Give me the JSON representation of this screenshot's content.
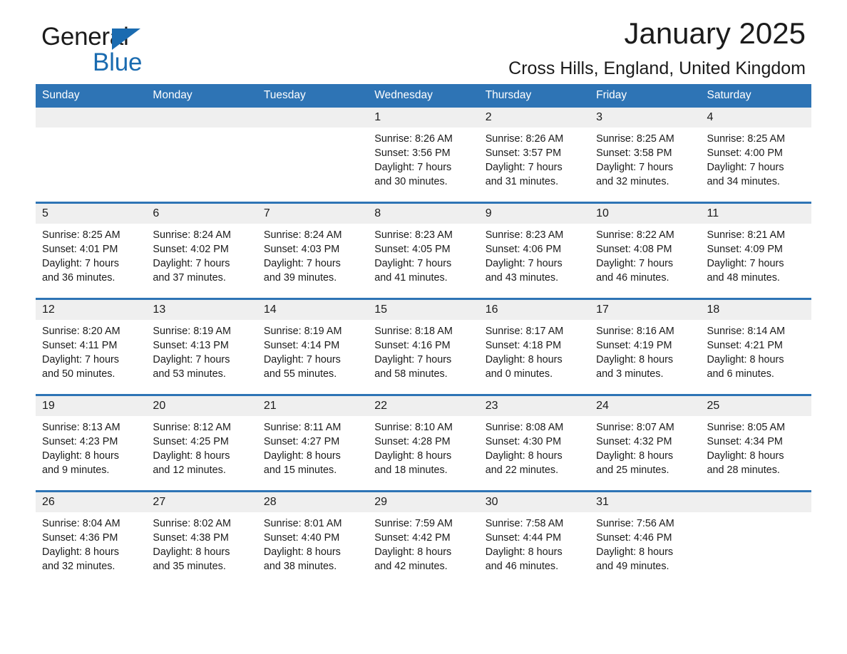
{
  "brand": {
    "name_part1": "General",
    "name_part2": "Blue",
    "triangle_color": "#1a6bb0",
    "logo_icon": "triangle-logo-icon"
  },
  "header": {
    "title": "January 2025",
    "subtitle": "Cross Hills, England, United Kingdom"
  },
  "theme": {
    "header_blue": "#2e74b5",
    "daynum_gray": "#efefef",
    "text": "#1b1b1b"
  },
  "calendar": {
    "weekday_headers": [
      "Sunday",
      "Monday",
      "Tuesday",
      "Wednesday",
      "Thursday",
      "Friday",
      "Saturday"
    ],
    "weeks": [
      [
        {
          "day": "",
          "empty": true
        },
        {
          "day": "",
          "empty": true
        },
        {
          "day": "",
          "empty": true
        },
        {
          "day": "1",
          "sunrise": "Sunrise: 8:26 AM",
          "sunset": "Sunset: 3:56 PM",
          "daylight_line1": "Daylight: 7 hours",
          "daylight_line2": "and 30 minutes."
        },
        {
          "day": "2",
          "sunrise": "Sunrise: 8:26 AM",
          "sunset": "Sunset: 3:57 PM",
          "daylight_line1": "Daylight: 7 hours",
          "daylight_line2": "and 31 minutes."
        },
        {
          "day": "3",
          "sunrise": "Sunrise: 8:25 AM",
          "sunset": "Sunset: 3:58 PM",
          "daylight_line1": "Daylight: 7 hours",
          "daylight_line2": "and 32 minutes."
        },
        {
          "day": "4",
          "sunrise": "Sunrise: 8:25 AM",
          "sunset": "Sunset: 4:00 PM",
          "daylight_line1": "Daylight: 7 hours",
          "daylight_line2": "and 34 minutes."
        }
      ],
      [
        {
          "day": "5",
          "sunrise": "Sunrise: 8:25 AM",
          "sunset": "Sunset: 4:01 PM",
          "daylight_line1": "Daylight: 7 hours",
          "daylight_line2": "and 36 minutes."
        },
        {
          "day": "6",
          "sunrise": "Sunrise: 8:24 AM",
          "sunset": "Sunset: 4:02 PM",
          "daylight_line1": "Daylight: 7 hours",
          "daylight_line2": "and 37 minutes."
        },
        {
          "day": "7",
          "sunrise": "Sunrise: 8:24 AM",
          "sunset": "Sunset: 4:03 PM",
          "daylight_line1": "Daylight: 7 hours",
          "daylight_line2": "and 39 minutes."
        },
        {
          "day": "8",
          "sunrise": "Sunrise: 8:23 AM",
          "sunset": "Sunset: 4:05 PM",
          "daylight_line1": "Daylight: 7 hours",
          "daylight_line2": "and 41 minutes."
        },
        {
          "day": "9",
          "sunrise": "Sunrise: 8:23 AM",
          "sunset": "Sunset: 4:06 PM",
          "daylight_line1": "Daylight: 7 hours",
          "daylight_line2": "and 43 minutes."
        },
        {
          "day": "10",
          "sunrise": "Sunrise: 8:22 AM",
          "sunset": "Sunset: 4:08 PM",
          "daylight_line1": "Daylight: 7 hours",
          "daylight_line2": "and 46 minutes."
        },
        {
          "day": "11",
          "sunrise": "Sunrise: 8:21 AM",
          "sunset": "Sunset: 4:09 PM",
          "daylight_line1": "Daylight: 7 hours",
          "daylight_line2": "and 48 minutes."
        }
      ],
      [
        {
          "day": "12",
          "sunrise": "Sunrise: 8:20 AM",
          "sunset": "Sunset: 4:11 PM",
          "daylight_line1": "Daylight: 7 hours",
          "daylight_line2": "and 50 minutes."
        },
        {
          "day": "13",
          "sunrise": "Sunrise: 8:19 AM",
          "sunset": "Sunset: 4:13 PM",
          "daylight_line1": "Daylight: 7 hours",
          "daylight_line2": "and 53 minutes."
        },
        {
          "day": "14",
          "sunrise": "Sunrise: 8:19 AM",
          "sunset": "Sunset: 4:14 PM",
          "daylight_line1": "Daylight: 7 hours",
          "daylight_line2": "and 55 minutes."
        },
        {
          "day": "15",
          "sunrise": "Sunrise: 8:18 AM",
          "sunset": "Sunset: 4:16 PM",
          "daylight_line1": "Daylight: 7 hours",
          "daylight_line2": "and 58 minutes."
        },
        {
          "day": "16",
          "sunrise": "Sunrise: 8:17 AM",
          "sunset": "Sunset: 4:18 PM",
          "daylight_line1": "Daylight: 8 hours",
          "daylight_line2": "and 0 minutes."
        },
        {
          "day": "17",
          "sunrise": "Sunrise: 8:16 AM",
          "sunset": "Sunset: 4:19 PM",
          "daylight_line1": "Daylight: 8 hours",
          "daylight_line2": "and 3 minutes."
        },
        {
          "day": "18",
          "sunrise": "Sunrise: 8:14 AM",
          "sunset": "Sunset: 4:21 PM",
          "daylight_line1": "Daylight: 8 hours",
          "daylight_line2": "and 6 minutes."
        }
      ],
      [
        {
          "day": "19",
          "sunrise": "Sunrise: 8:13 AM",
          "sunset": "Sunset: 4:23 PM",
          "daylight_line1": "Daylight: 8 hours",
          "daylight_line2": "and 9 minutes."
        },
        {
          "day": "20",
          "sunrise": "Sunrise: 8:12 AM",
          "sunset": "Sunset: 4:25 PM",
          "daylight_line1": "Daylight: 8 hours",
          "daylight_line2": "and 12 minutes."
        },
        {
          "day": "21",
          "sunrise": "Sunrise: 8:11 AM",
          "sunset": "Sunset: 4:27 PM",
          "daylight_line1": "Daylight: 8 hours",
          "daylight_line2": "and 15 minutes."
        },
        {
          "day": "22",
          "sunrise": "Sunrise: 8:10 AM",
          "sunset": "Sunset: 4:28 PM",
          "daylight_line1": "Daylight: 8 hours",
          "daylight_line2": "and 18 minutes."
        },
        {
          "day": "23",
          "sunrise": "Sunrise: 8:08 AM",
          "sunset": "Sunset: 4:30 PM",
          "daylight_line1": "Daylight: 8 hours",
          "daylight_line2": "and 22 minutes."
        },
        {
          "day": "24",
          "sunrise": "Sunrise: 8:07 AM",
          "sunset": "Sunset: 4:32 PM",
          "daylight_line1": "Daylight: 8 hours",
          "daylight_line2": "and 25 minutes."
        },
        {
          "day": "25",
          "sunrise": "Sunrise: 8:05 AM",
          "sunset": "Sunset: 4:34 PM",
          "daylight_line1": "Daylight: 8 hours",
          "daylight_line2": "and 28 minutes."
        }
      ],
      [
        {
          "day": "26",
          "sunrise": "Sunrise: 8:04 AM",
          "sunset": "Sunset: 4:36 PM",
          "daylight_line1": "Daylight: 8 hours",
          "daylight_line2": "and 32 minutes."
        },
        {
          "day": "27",
          "sunrise": "Sunrise: 8:02 AM",
          "sunset": "Sunset: 4:38 PM",
          "daylight_line1": "Daylight: 8 hours",
          "daylight_line2": "and 35 minutes."
        },
        {
          "day": "28",
          "sunrise": "Sunrise: 8:01 AM",
          "sunset": "Sunset: 4:40 PM",
          "daylight_line1": "Daylight: 8 hours",
          "daylight_line2": "and 38 minutes."
        },
        {
          "day": "29",
          "sunrise": "Sunrise: 7:59 AM",
          "sunset": "Sunset: 4:42 PM",
          "daylight_line1": "Daylight: 8 hours",
          "daylight_line2": "and 42 minutes."
        },
        {
          "day": "30",
          "sunrise": "Sunrise: 7:58 AM",
          "sunset": "Sunset: 4:44 PM",
          "daylight_line1": "Daylight: 8 hours",
          "daylight_line2": "and 46 minutes."
        },
        {
          "day": "31",
          "sunrise": "Sunrise: 7:56 AM",
          "sunset": "Sunset: 4:46 PM",
          "daylight_line1": "Daylight: 8 hours",
          "daylight_line2": "and 49 minutes."
        },
        {
          "day": "",
          "empty": true
        }
      ]
    ]
  }
}
